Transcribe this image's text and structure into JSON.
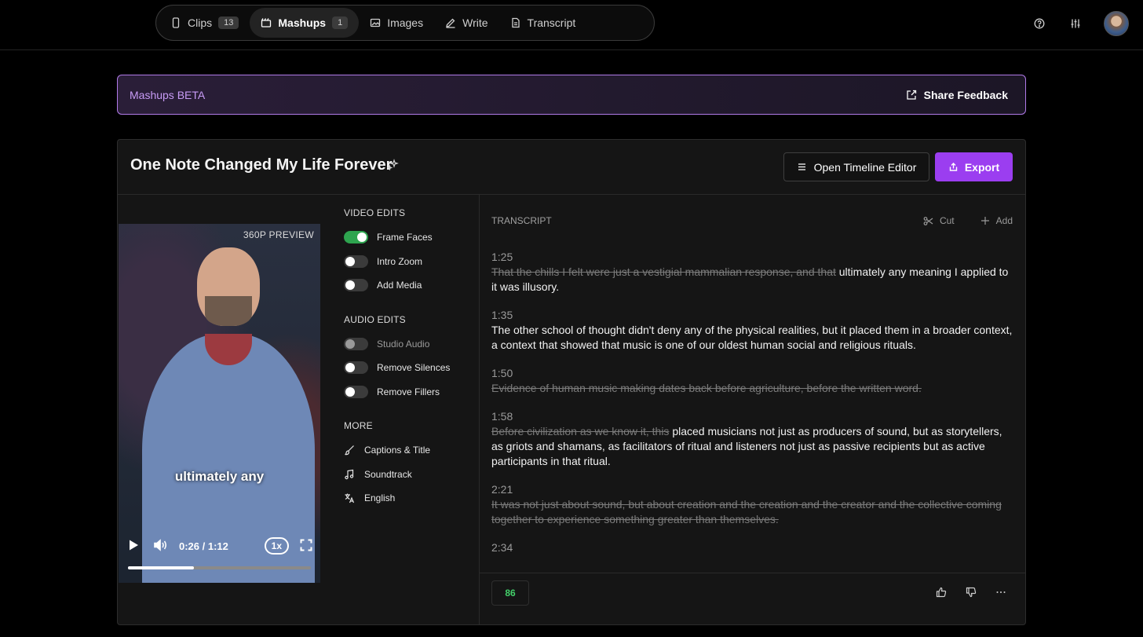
{
  "nav": {
    "tabs": [
      {
        "label": "Clips",
        "count": "13"
      },
      {
        "label": "Mashups",
        "count": "1"
      },
      {
        "label": "Images"
      },
      {
        "label": "Write"
      },
      {
        "label": "Transcript"
      }
    ]
  },
  "banner": {
    "title": "Mashups BETA",
    "feedback": "Share Feedback"
  },
  "card": {
    "title": "One Note Changed My Life Forever",
    "timeline_button": "Open Timeline Editor",
    "export_button": "Export"
  },
  "video": {
    "preview_label": "360P PREVIEW",
    "caption": "ultimately any",
    "time": "0:26 / 1:12",
    "speed": "1x",
    "progress": 0.36
  },
  "edits": {
    "video_title": "VIDEO EDITS",
    "video": [
      "Frame Faces",
      "Intro Zoom",
      "Add Media"
    ],
    "audio_title": "AUDIO EDITS",
    "audio": [
      "Studio Audio",
      "Remove Silences",
      "Remove Fillers"
    ],
    "more_title": "MORE",
    "more": [
      "Captions & Title",
      "Soundtrack",
      "English"
    ]
  },
  "transcript": {
    "label": "TRANSCRIPT",
    "cut": "Cut",
    "add": "Add",
    "segments": [
      {
        "time": "1:25",
        "cut": "That the chills I felt were just a vestigial mammalian response, and that",
        "kept": " ultimately any meaning I applied to it was illusory."
      },
      {
        "time": "1:35",
        "cut": "",
        "kept": "The other school of thought didn't deny any of the physical realities, but it placed them in a broader context, a context that showed that music is one of our oldest human social and religious rituals."
      },
      {
        "time": "1:50",
        "cut": "Evidence of human music making dates back before agriculture, before the written word.",
        "kept": ""
      },
      {
        "time": "1:58",
        "cut": "Before civilization as we know it, this",
        "kept": " placed musicians not just as producers of sound, but as storytellers, as griots and shamans, as facilitators of ritual and listeners not just as passive recipients but as active participants in that ritual."
      },
      {
        "time": "2:21",
        "cut": "It was not just about sound, but about creation and the creation and the creator and the collective coming together to experience something greater than themselves.",
        "kept": ""
      },
      {
        "time": "2:34",
        "cut": "",
        "kept": ""
      }
    ],
    "score": "86"
  },
  "colors": {
    "accent": "#9b3ef0",
    "toggle_on": "#2ea44f",
    "score": "#43d06a"
  }
}
